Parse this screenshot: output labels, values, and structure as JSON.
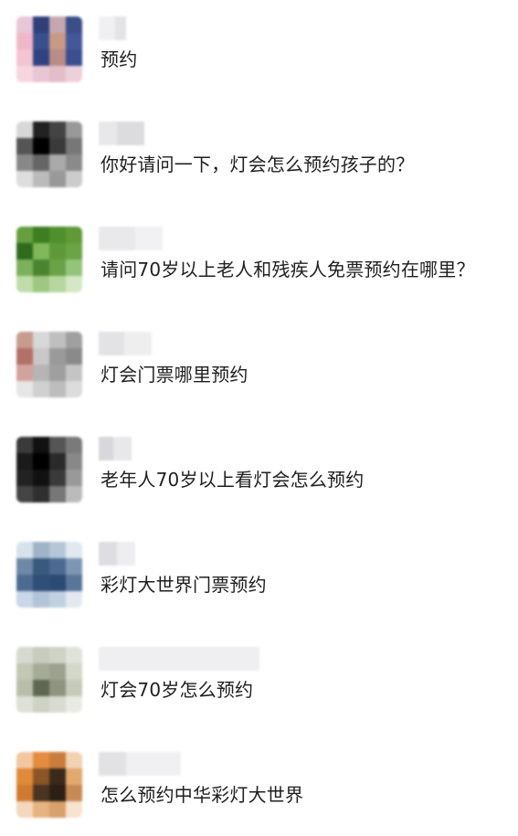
{
  "comments": [
    {
      "text": "预约"
    },
    {
      "text": "你好请问一下，灯会怎么预约孩子的？"
    },
    {
      "text": "请问70岁以上老人和残疾人免票预约在哪里？"
    },
    {
      "text": "灯会门票哪里预约"
    },
    {
      "text": "老年人70岁以上看灯会怎么预约"
    },
    {
      "text": "彩灯大世界门票预约"
    },
    {
      "text": "灯会70岁怎么预约"
    },
    {
      "text": "怎么预约中华彩灯大世界"
    }
  ],
  "colors": {
    "background": "#ffffff",
    "text": "#1f1f1f",
    "name_placeholder": "#e9e9ec"
  }
}
